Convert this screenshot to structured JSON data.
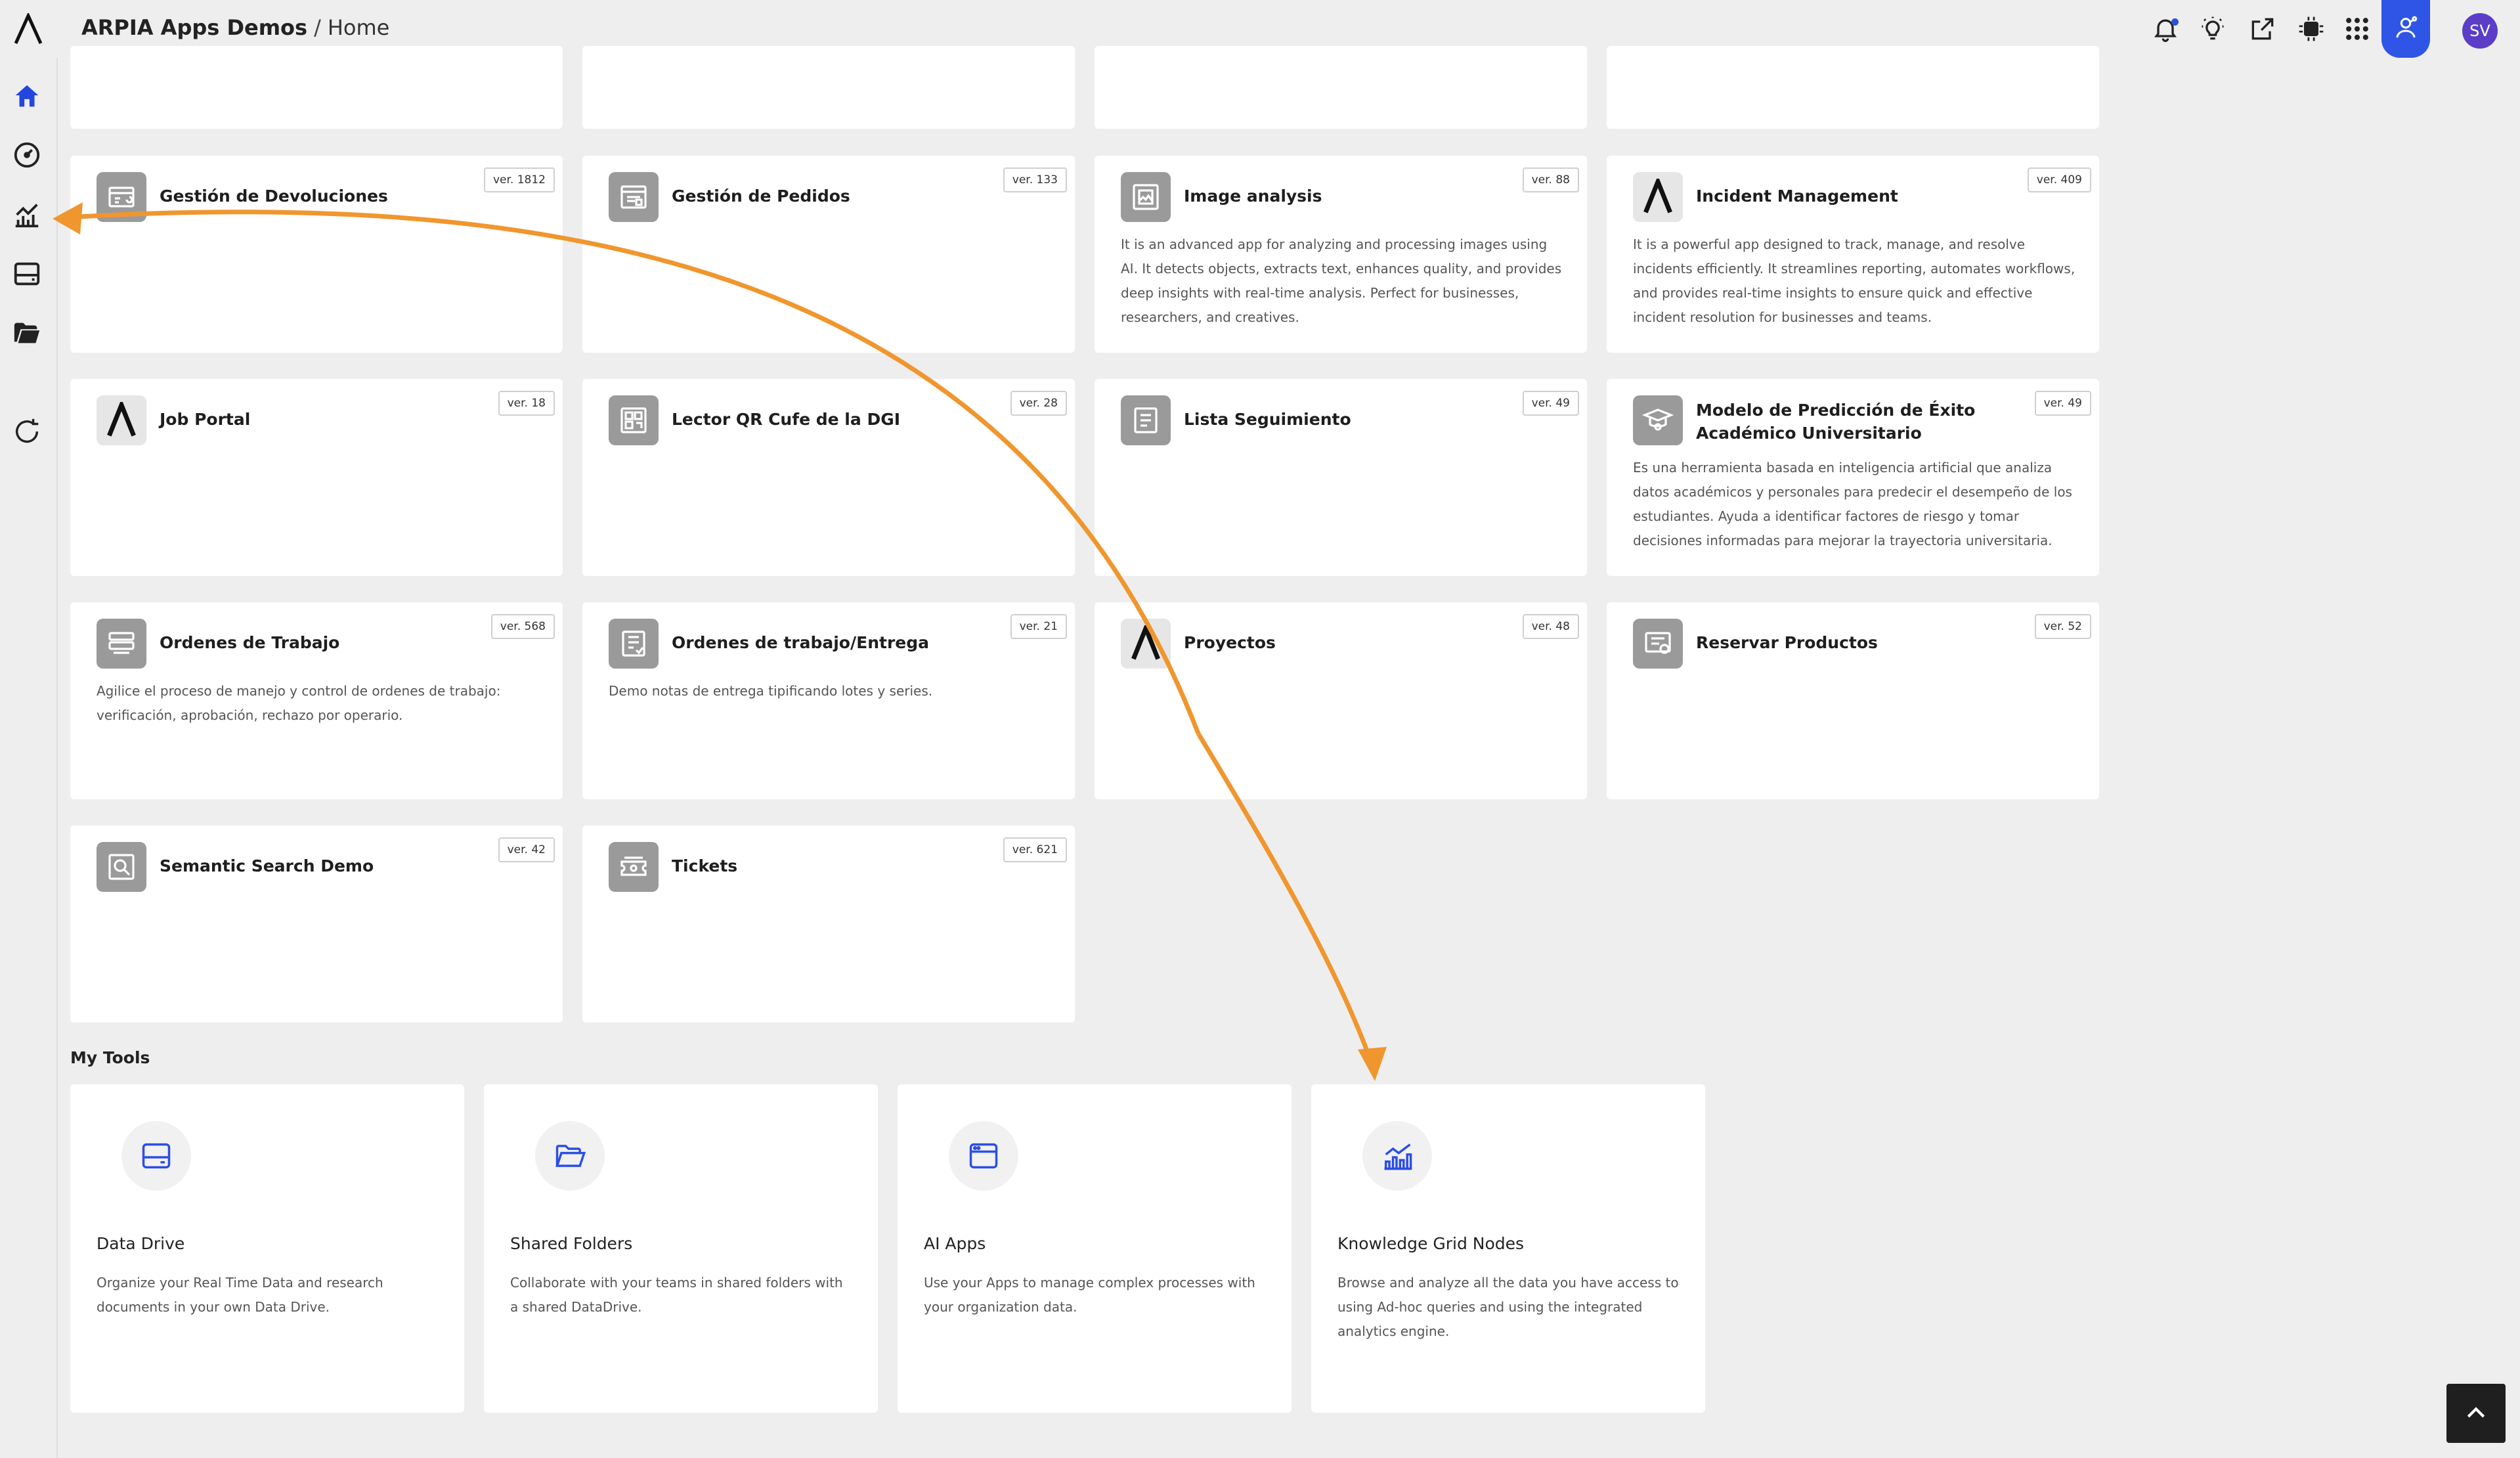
{
  "header": {
    "org": "ARPIA Apps Demos",
    "separator": "/",
    "page": "Home",
    "avatar_initials": "SV",
    "icons": [
      "bell-icon",
      "lightbulb-icon",
      "share-icon",
      "cpu-chip-icon",
      "apps-grid-icon",
      "user-network-icon"
    ]
  },
  "sidebar": {
    "items": [
      "home-icon",
      "dashboard-icon",
      "analytics-chart-icon",
      "data-drive-icon",
      "folder-icon",
      "refresh-icon"
    ]
  },
  "apps": [
    {
      "title": "Gestión de Devoluciones",
      "version": "ver. 1812",
      "icon": "returns-icon",
      "description": ""
    },
    {
      "title": "Gestión de Pedidos",
      "version": "ver. 133",
      "icon": "orders-icon",
      "description": ""
    },
    {
      "title": "Image analysis",
      "version": "ver. 88",
      "icon": "image-analysis-icon",
      "description": "It is an advanced app for analyzing and processing images using AI. It detects objects, extracts text, enhances quality, and provides deep insights with real-time analysis. Perfect for businesses, researchers, and creatives."
    },
    {
      "title": "Incident Management",
      "version": "ver. 409",
      "icon": "arpia-logo-icon",
      "description": "It is a powerful app designed to track, manage, and resolve incidents efficiently. It streamlines reporting, automates workflows, and provides real-time insights to ensure quick and effective incident resolution for businesses and teams."
    },
    {
      "title": "Job Portal",
      "version": "ver. 18",
      "icon": "arpia-logo-icon",
      "description": ""
    },
    {
      "title": "Lector QR Cufe de la DGI",
      "version": "ver. 28",
      "icon": "qr-reader-icon",
      "description": ""
    },
    {
      "title": "Lista Seguimiento",
      "version": "ver. 49",
      "icon": "list-icon",
      "description": ""
    },
    {
      "title": "Modelo de Predicción de Éxito Académico Universitario",
      "version": "ver. 49",
      "icon": "graduate-icon",
      "description": "Es una herramienta basada en inteligencia artificial que analiza datos académicos y personales para predecir el desempeño de los estudiantes. Ayuda a identificar factores de riesgo y tomar decisiones informadas para mejorar la trayectoria universitaria."
    },
    {
      "title": "Ordenes de Trabajo",
      "version": "ver. 568",
      "icon": "work-orders-icon",
      "description": "Agilice el proceso de manejo y control de ordenes de trabajo: verificación, aprobación, rechazo por operario."
    },
    {
      "title": "Ordenes de trabajo/Entrega",
      "version": "ver. 21",
      "icon": "delivery-orders-icon",
      "description": "Demo notas de entrega tipificando lotes y series."
    },
    {
      "title": "Proyectos",
      "version": "ver. 48",
      "icon": "arpia-logo-icon",
      "description": ""
    },
    {
      "title": "Reservar Productos",
      "version": "ver. 52",
      "icon": "reserve-products-icon",
      "description": ""
    },
    {
      "title": "Semantic Search Demo",
      "version": "ver. 42",
      "icon": "semantic-search-icon",
      "description": ""
    },
    {
      "title": "Tickets",
      "version": "ver. 621",
      "icon": "tickets-icon",
      "description": ""
    }
  ],
  "tools_section": {
    "title": "My Tools",
    "items": [
      {
        "title": "Data Drive",
        "description": "Organize your Real Time Data and research documents in your own Data Drive.",
        "icon": "data-drive-icon"
      },
      {
        "title": "Shared Folders",
        "description": "Collaborate with your teams in shared folders with a shared DataDrive.",
        "icon": "open-folder-icon"
      },
      {
        "title": "AI Apps",
        "description": "Use your Apps to manage complex processes with your organization data.",
        "icon": "app-window-icon"
      },
      {
        "title": "Knowledge Grid Nodes",
        "description": "Browse and analyze all the data you have access to using Ad-hoc queries and using the integrated analytics engine.",
        "icon": "analytics-chart-icon"
      }
    ]
  },
  "colors": {
    "background": "#eeeeee",
    "card": "#ffffff",
    "accent": "#2f55e6",
    "avatar": "#5a3ec8",
    "annotation_arrow": "#f0962e",
    "app_icon_bg": "#9a9a9a"
  }
}
